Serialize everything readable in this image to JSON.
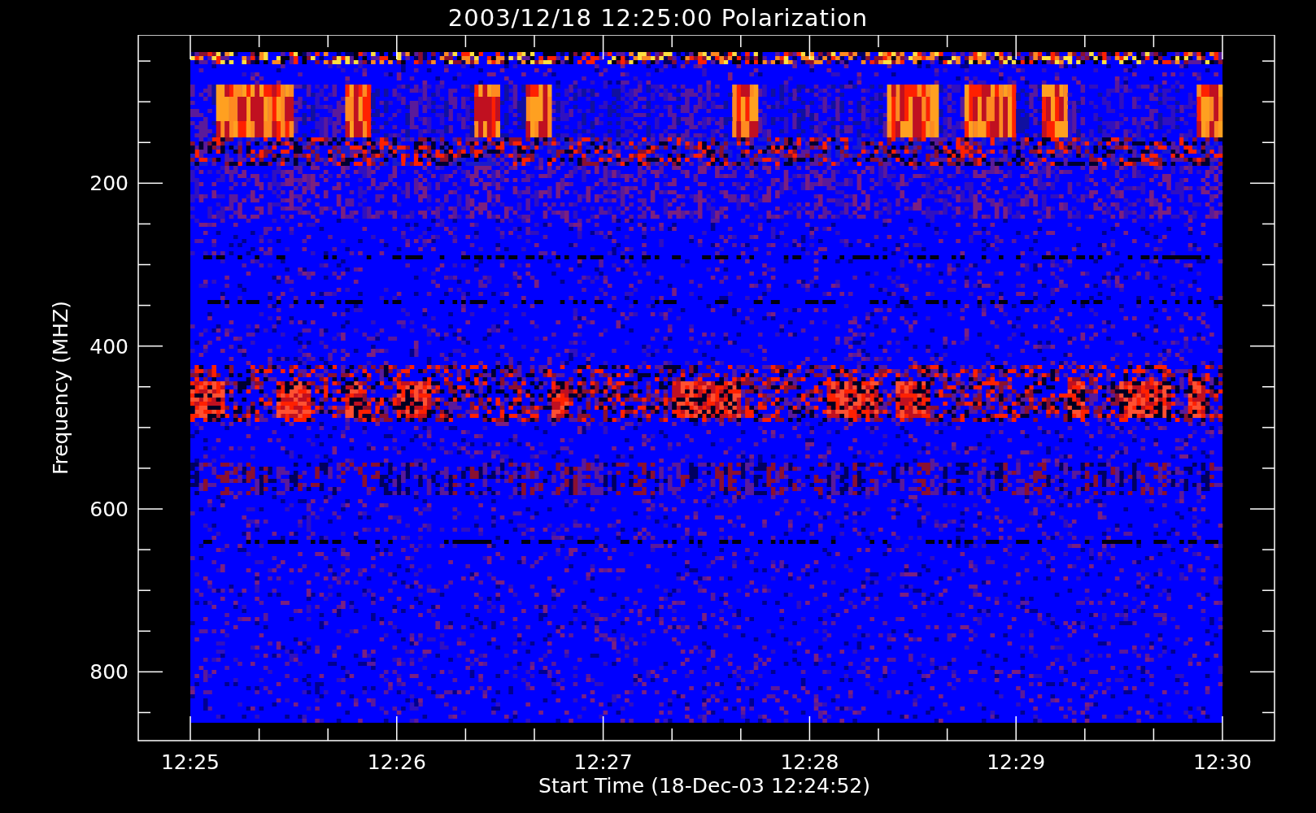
{
  "title": "2003/12/18 12:25:00 Polarization",
  "y_axis": {
    "label": "Frequency (MHZ)",
    "ticks": [
      "200",
      "400",
      "600",
      "800"
    ]
  },
  "x_axis": {
    "label": "Start Time (18-Dec-03 12:24:52)",
    "ticks": [
      "12:25",
      "12:26",
      "12:27",
      "12:28",
      "12:29",
      "12:30"
    ]
  }
}
